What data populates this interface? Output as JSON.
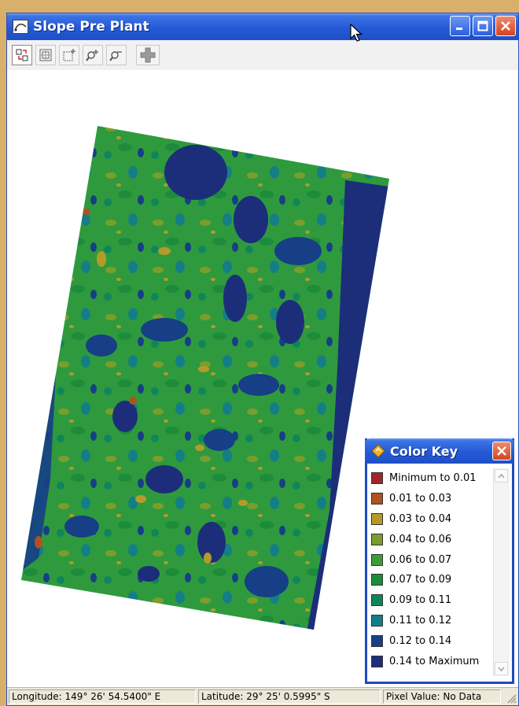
{
  "window": {
    "title": "Slope Pre Plant"
  },
  "toolbar": {
    "tools": [
      {
        "name": "select-tool-icon"
      },
      {
        "name": "zoom-extent-icon"
      },
      {
        "name": "zoom-box-icon"
      },
      {
        "name": "zoom-in-icon"
      },
      {
        "name": "zoom-out-icon"
      },
      {
        "name": "add-icon"
      }
    ]
  },
  "status": {
    "longitude": "Longitude:  149°  26'  54.5400\" E",
    "latitude": "Latitude:   29°  25'   0.5995\" S",
    "pixel": "Pixel Value: No Data"
  },
  "color_key": {
    "title": "Color Key",
    "items": [
      {
        "label": "Minimum to 0.01",
        "color": "#a1252a"
      },
      {
        "label": "0.01 to 0.03",
        "color": "#b0521f"
      },
      {
        "label": "0.03 to 0.04",
        "color": "#b59a2a"
      },
      {
        "label": "0.04 to 0.06",
        "color": "#7a9d2c"
      },
      {
        "label": "0.06 to 0.07",
        "color": "#3f9a38"
      },
      {
        "label": "0.07 to 0.09",
        "color": "#1c8c3b"
      },
      {
        "label": "0.09 to 0.11",
        "color": "#11855a"
      },
      {
        "label": "0.11 to 0.12",
        "color": "#147e87"
      },
      {
        "label": "0.12 to 0.14",
        "color": "#163f86"
      },
      {
        "label": "0.14 to Maximum",
        "color": "#1c2e7a"
      }
    ]
  }
}
